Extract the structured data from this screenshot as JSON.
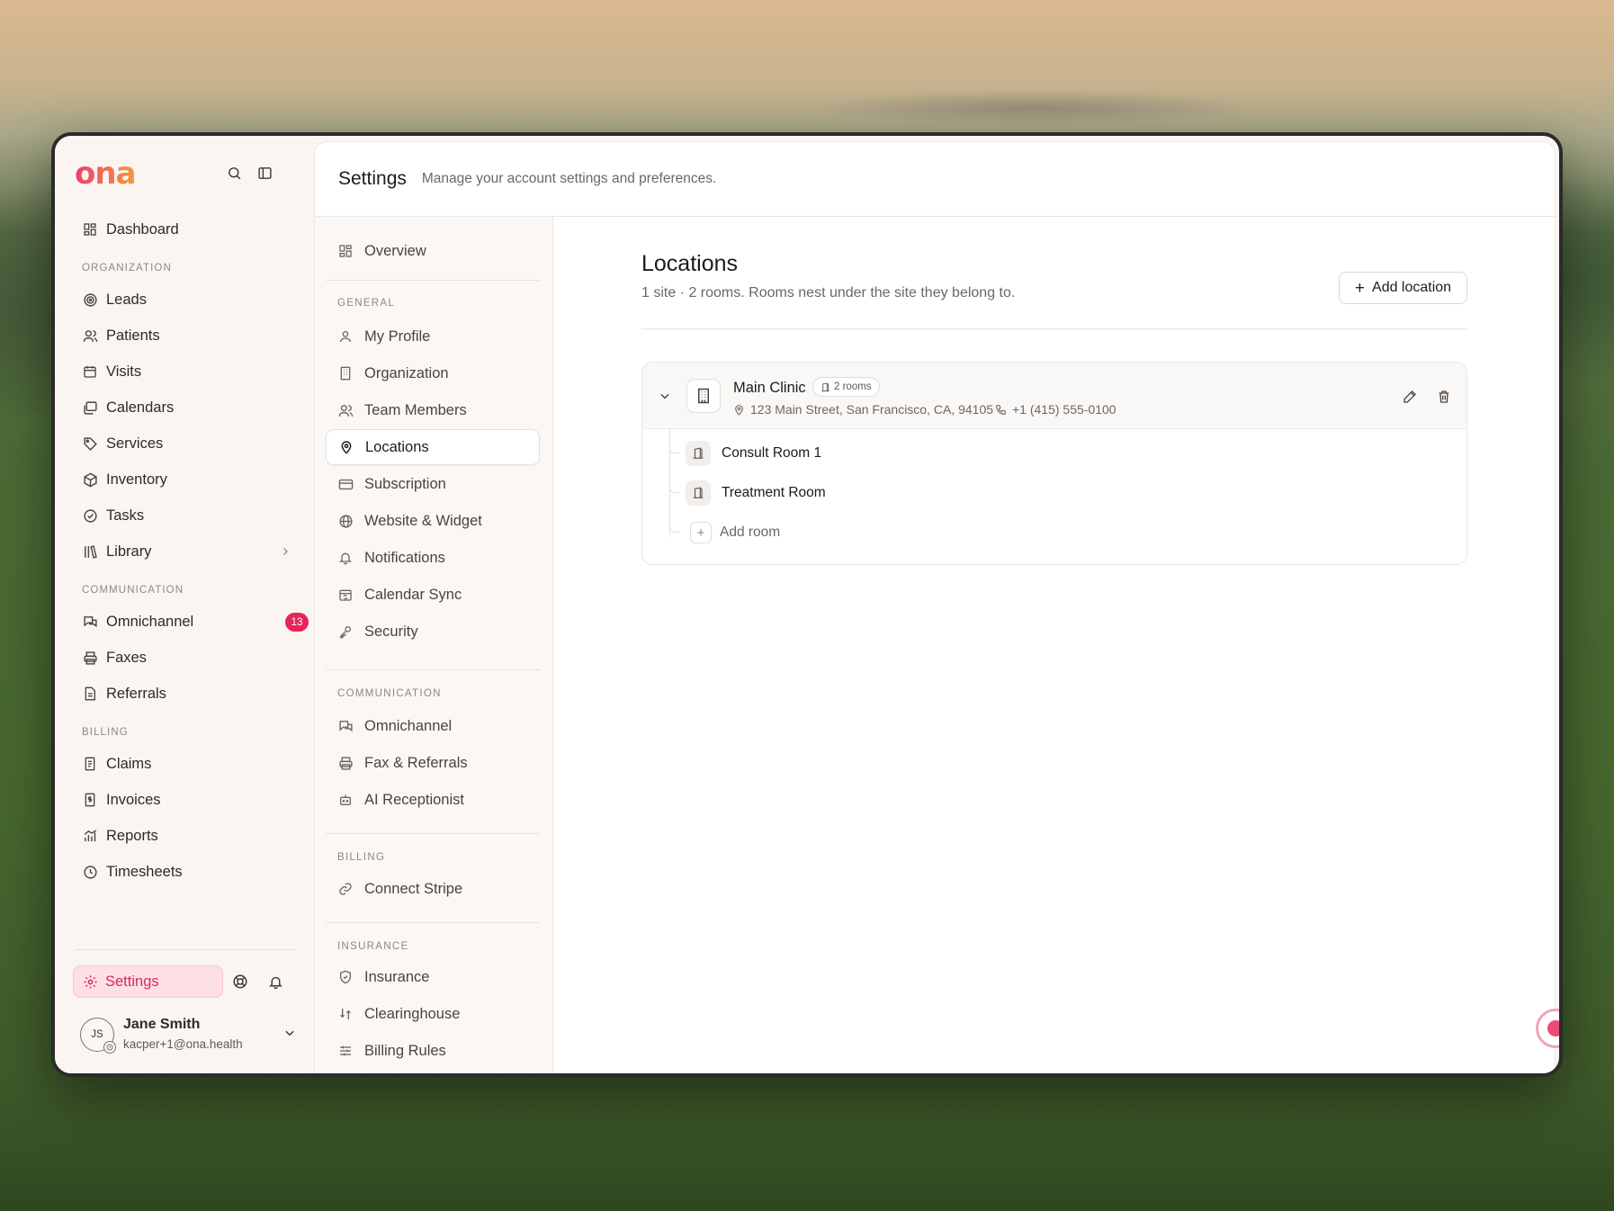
{
  "app": {
    "logo": "ona"
  },
  "sidebar": {
    "dashboard": "Dashboard",
    "sections": {
      "organization": "ORGANIZATION",
      "communication": "COMMUNICATION",
      "billing": "BILLING"
    },
    "organization_items": [
      {
        "label": "Leads",
        "icon": "target-icon"
      },
      {
        "label": "Patients",
        "icon": "users-icon"
      },
      {
        "label": "Visits",
        "icon": "calendar-check-icon"
      },
      {
        "label": "Calendars",
        "icon": "calendars-icon"
      },
      {
        "label": "Services",
        "icon": "tag-icon"
      },
      {
        "label": "Inventory",
        "icon": "box-icon"
      },
      {
        "label": "Tasks",
        "icon": "check-circle-icon"
      },
      {
        "label": "Library",
        "icon": "library-icon"
      }
    ],
    "communication_items": [
      {
        "label": "Omnichannel",
        "icon": "chat-icon",
        "badge": "13"
      },
      {
        "label": "Faxes",
        "icon": "printer-icon"
      },
      {
        "label": "Referrals",
        "icon": "document-icon"
      }
    ],
    "billing_items": [
      {
        "label": "Claims",
        "icon": "claims-icon"
      },
      {
        "label": "Invoices",
        "icon": "invoice-icon"
      },
      {
        "label": "Reports",
        "icon": "chart-icon"
      },
      {
        "label": "Timesheets",
        "icon": "clock-icon"
      }
    ],
    "settings_label": "Settings",
    "user": {
      "initials": "JS",
      "name": "Jane Smith",
      "email": "kacper+1@ona.health"
    },
    "accent_color": "#e8245a"
  },
  "header": {
    "title": "Settings",
    "subtitle": "Manage your account settings and preferences."
  },
  "settings_nav": {
    "overview": "Overview",
    "general_section": "GENERAL",
    "general": [
      "My Profile",
      "Organization",
      "Team Members",
      "Locations",
      "Subscription",
      "Website & Widget",
      "Notifications",
      "Calendar Sync",
      "Security"
    ],
    "communication_section": "COMMUNICATION",
    "communication": [
      "Omnichannel",
      "Fax & Referrals",
      "AI Receptionist"
    ],
    "billing_section": "BILLING",
    "billing": [
      "Connect Stripe"
    ],
    "insurance_section": "INSURANCE",
    "insurance": [
      "Insurance",
      "Clearinghouse",
      "Billing Rules"
    ],
    "active": "Locations"
  },
  "locations": {
    "title": "Locations",
    "subtitle": "1 site · 2 rooms. Rooms nest under the site they belong to.",
    "add_button": "Add location",
    "site": {
      "name": "Main Clinic",
      "rooms_badge": "2 rooms",
      "address": "123 Main Street, San Francisco, CA, 94105",
      "phone": "+1 (415) 555-0100"
    },
    "rooms": [
      "Consult Room 1",
      "Treatment Room"
    ],
    "add_room": "Add room"
  }
}
